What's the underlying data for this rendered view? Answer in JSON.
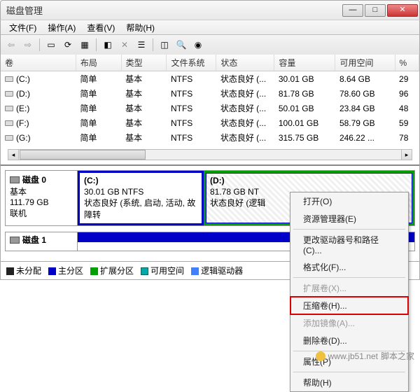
{
  "window": {
    "title": "磁盘管理"
  },
  "menu": {
    "file": "文件(F)",
    "action": "操作(A)",
    "view": "查看(V)",
    "help": "帮助(H)"
  },
  "columns": {
    "vol": "卷",
    "layout": "布局",
    "type": "类型",
    "fs": "文件系统",
    "status": "状态",
    "capacity": "容量",
    "free": "可用空间",
    "pct": "%"
  },
  "rows": [
    {
      "vol": "(C:)",
      "layout": "简单",
      "type": "基本",
      "fs": "NTFS",
      "status": "状态良好 (...",
      "capacity": "30.01 GB",
      "free": "8.64 GB",
      "pct": "29"
    },
    {
      "vol": "(D:)",
      "layout": "简单",
      "type": "基本",
      "fs": "NTFS",
      "status": "状态良好 (...",
      "capacity": "81.78 GB",
      "free": "78.60 GB",
      "pct": "96"
    },
    {
      "vol": "(E:)",
      "layout": "简单",
      "type": "基本",
      "fs": "NTFS",
      "status": "状态良好 (...",
      "capacity": "50.01 GB",
      "free": "23.84 GB",
      "pct": "48"
    },
    {
      "vol": "(F:)",
      "layout": "简单",
      "type": "基本",
      "fs": "NTFS",
      "status": "状态良好 (...",
      "capacity": "100.01 GB",
      "free": "58.79 GB",
      "pct": "59"
    },
    {
      "vol": "(G:)",
      "layout": "简单",
      "type": "基本",
      "fs": "NTFS",
      "status": "状态良好 (...",
      "capacity": "315.75 GB",
      "free": "246.22 ...",
      "pct": "78"
    }
  ],
  "disk0": {
    "name": "磁盘 0",
    "type": "基本",
    "size": "111.79 GB",
    "status": "联机",
    "partC": {
      "label": "(C:)",
      "line2": "30.01 GB NTFS",
      "line3": "状态良好 (系统, 启动, 活动, 故障转"
    },
    "partD": {
      "label": "(D:)",
      "line2": "81.78 GB NT",
      "line3": "状态良好 (逻辑"
    }
  },
  "disk1": {
    "name": "磁盘 1"
  },
  "legend": {
    "unalloc": "未分配",
    "primary": "主分区",
    "extended": "扩展分区",
    "free": "可用空间",
    "logical": "逻辑驱动器"
  },
  "ctx": {
    "open": "打开(O)",
    "explorer": "资源管理器(E)",
    "changeletter": "更改驱动器号和路径(C)...",
    "format": "格式化(F)...",
    "extend": "扩展卷(X)...",
    "shrink": "压缩卷(H)...",
    "mirror": "添加镜像(A)...",
    "delete": "删除卷(D)...",
    "props": "属性(P)",
    "help": "帮助(H)"
  },
  "watermark": {
    "text": "脚本之家",
    "url": "www.jb51.net"
  }
}
